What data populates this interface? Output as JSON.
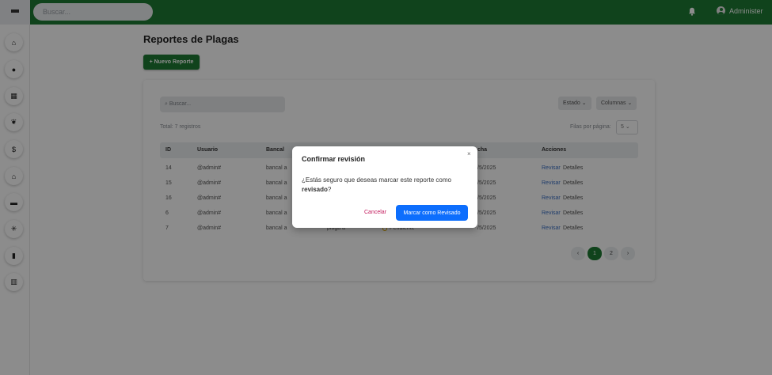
{
  "topbar": {
    "search_placeholder": "Buscar...",
    "user_name": "Administer"
  },
  "sidebar": {
    "items": [
      {
        "icon": "home-icon",
        "glyph": "⌂"
      },
      {
        "icon": "user-icon",
        "glyph": "●"
      },
      {
        "icon": "calendar-icon",
        "glyph": "▦"
      },
      {
        "icon": "leaf-icon",
        "glyph": "❦"
      },
      {
        "icon": "dollar-icon",
        "glyph": "$"
      },
      {
        "icon": "warehouse-icon",
        "glyph": "⌂"
      },
      {
        "icon": "briefcase-icon",
        "glyph": "▬"
      },
      {
        "icon": "bug-icon",
        "glyph": "✳"
      },
      {
        "icon": "document-icon",
        "glyph": "▮"
      },
      {
        "icon": "chart-icon",
        "glyph": "▥"
      }
    ]
  },
  "main": {
    "title": "Reportes de Plagas",
    "new_button": "+ Nuevo Reporte",
    "table_search_placeholder": "⌕ Buscar...",
    "filter_estado": "Estado ⌄",
    "filter_columnas": "Columnas ⌄",
    "total_text": "Total: 7 registros",
    "per_page_label": "Filas por página:",
    "per_page_value": "5 ⌄",
    "headers": [
      "ID",
      "Usuario",
      "Bancal",
      "cha",
      "Acciones"
    ],
    "rows": [
      {
        "id": "14",
        "user": "@admin#",
        "bancal": "bancal a",
        "date": "/5/2025",
        "action1": "Revisar",
        "action2": "Detalles"
      },
      {
        "id": "15",
        "user": "@admin#",
        "bancal": "bancal a",
        "date": "/5/2025",
        "action1": "Revisar",
        "action2": "Detalles"
      },
      {
        "id": "16",
        "user": "@admin#",
        "bancal": "bancal a",
        "date": "/5/2025",
        "action1": "Revisar",
        "action2": "Detalles"
      },
      {
        "id": "6",
        "user": "@admin#",
        "bancal": "bancal a",
        "date": "/5/2025",
        "action1": "Revisar",
        "action2": "Detalles"
      },
      {
        "id": "7",
        "user": "@admin#",
        "bancal": "bancal a",
        "plaga": "plaga a",
        "estado": "Pendiente",
        "date": "/5/2025",
        "action1": "Revisar",
        "action2": "Detalles"
      }
    ],
    "pagination": {
      "prev": "‹",
      "pages": [
        "1",
        "2"
      ],
      "next": "›",
      "current": "1"
    }
  },
  "modal": {
    "title": "Confirmar revisión",
    "close": "×",
    "body_prefix": "¿Estás seguro que deseas marcar este reporte como ",
    "body_strong": "revisado",
    "body_suffix": "?",
    "cancel": "Cancelar",
    "confirm": "Marcar como Revisado"
  },
  "colors": {
    "brand_green": "#1e7b33",
    "primary_blue": "#0d6efd",
    "cancel_pink": "#c2185b"
  }
}
